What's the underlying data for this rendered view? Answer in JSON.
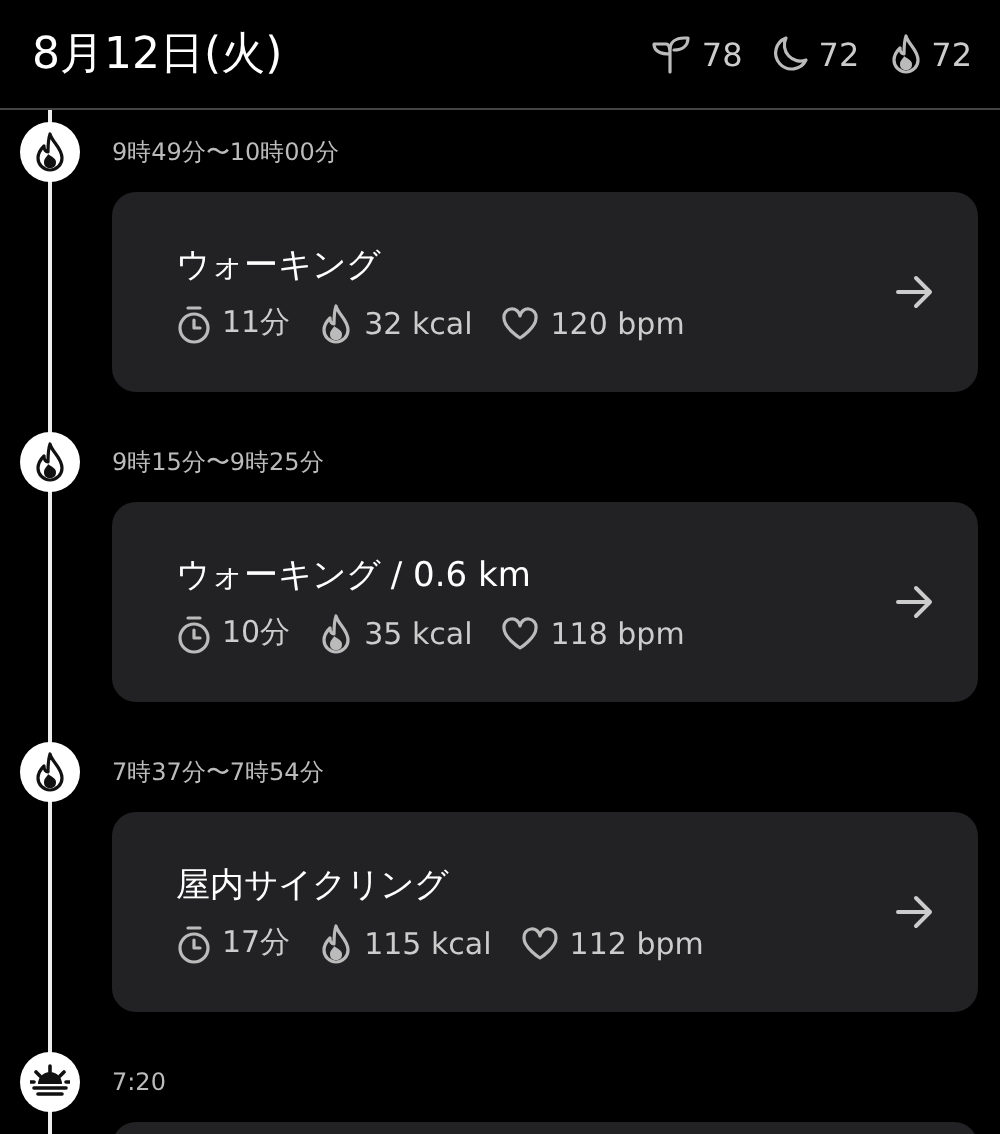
{
  "header": {
    "date": "8月12日(火)",
    "scores": [
      {
        "kind": "sprout",
        "value": "78"
      },
      {
        "kind": "moon",
        "value": "72"
      },
      {
        "kind": "flame",
        "value": "72"
      }
    ]
  },
  "events": [
    {
      "kind": "workout",
      "time": "9時49分〜10時00分",
      "card": {
        "title": "ウォーキング",
        "duration": "11分",
        "calories": "32 kcal",
        "heart_rate": "120 bpm"
      }
    },
    {
      "kind": "workout",
      "time": "9時15分〜9時25分",
      "card": {
        "title": "ウォーキング / 0.6 km",
        "duration": "10分",
        "calories": "35 kcal",
        "heart_rate": "118 bpm"
      }
    },
    {
      "kind": "workout",
      "time": "7時37分〜7時54分",
      "card": {
        "title": "屋内サイクリング",
        "duration": "17分",
        "calories": "115 kcal",
        "heart_rate": "112 bpm"
      }
    },
    {
      "kind": "sunrise",
      "time": "7:20"
    }
  ]
}
